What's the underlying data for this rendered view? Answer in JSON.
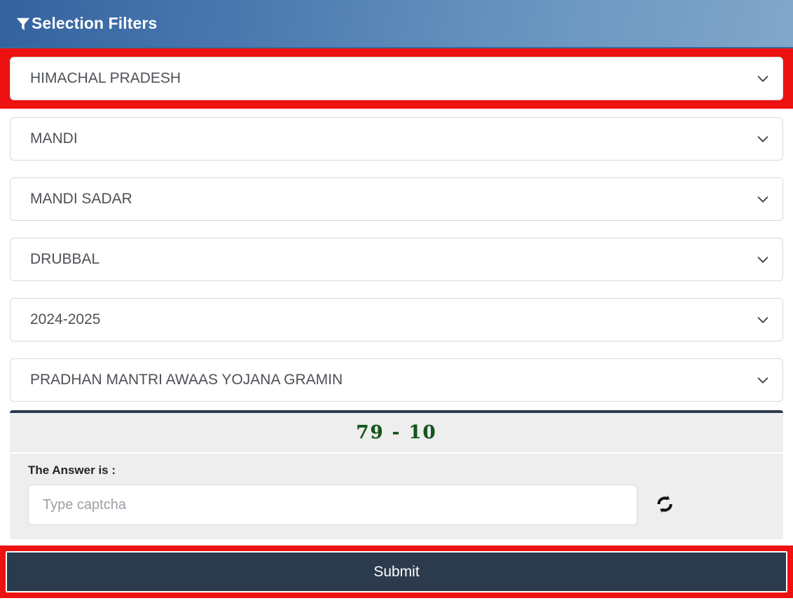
{
  "header": {
    "title": "Selection Filters",
    "icon": "funnel-icon",
    "gradient_from": "#33639f",
    "gradient_to": "#82a7c9"
  },
  "highlight_color": "#ee1111",
  "filters": [
    {
      "name": "state",
      "value": "HIMACHAL PRADESH",
      "highlighted": true
    },
    {
      "name": "district",
      "value": "MANDI",
      "highlighted": false
    },
    {
      "name": "block",
      "value": "MANDI SADAR",
      "highlighted": false
    },
    {
      "name": "panchayat",
      "value": "DRUBBAL",
      "highlighted": false
    },
    {
      "name": "financial-year",
      "value": "2024-2025",
      "highlighted": false
    },
    {
      "name": "scheme",
      "value": "PRADHAN MANTRI AWAAS YOJANA GRAMIN",
      "highlighted": false
    }
  ],
  "captcha": {
    "challenge": "79 - 10",
    "challenge_color": "#14561c",
    "answer_label": "The Answer is :",
    "input_value": "",
    "input_placeholder": "Type captcha",
    "refresh_icon": "refresh-icon"
  },
  "submit": {
    "label": "Submit",
    "background": "#2b3a4d"
  }
}
